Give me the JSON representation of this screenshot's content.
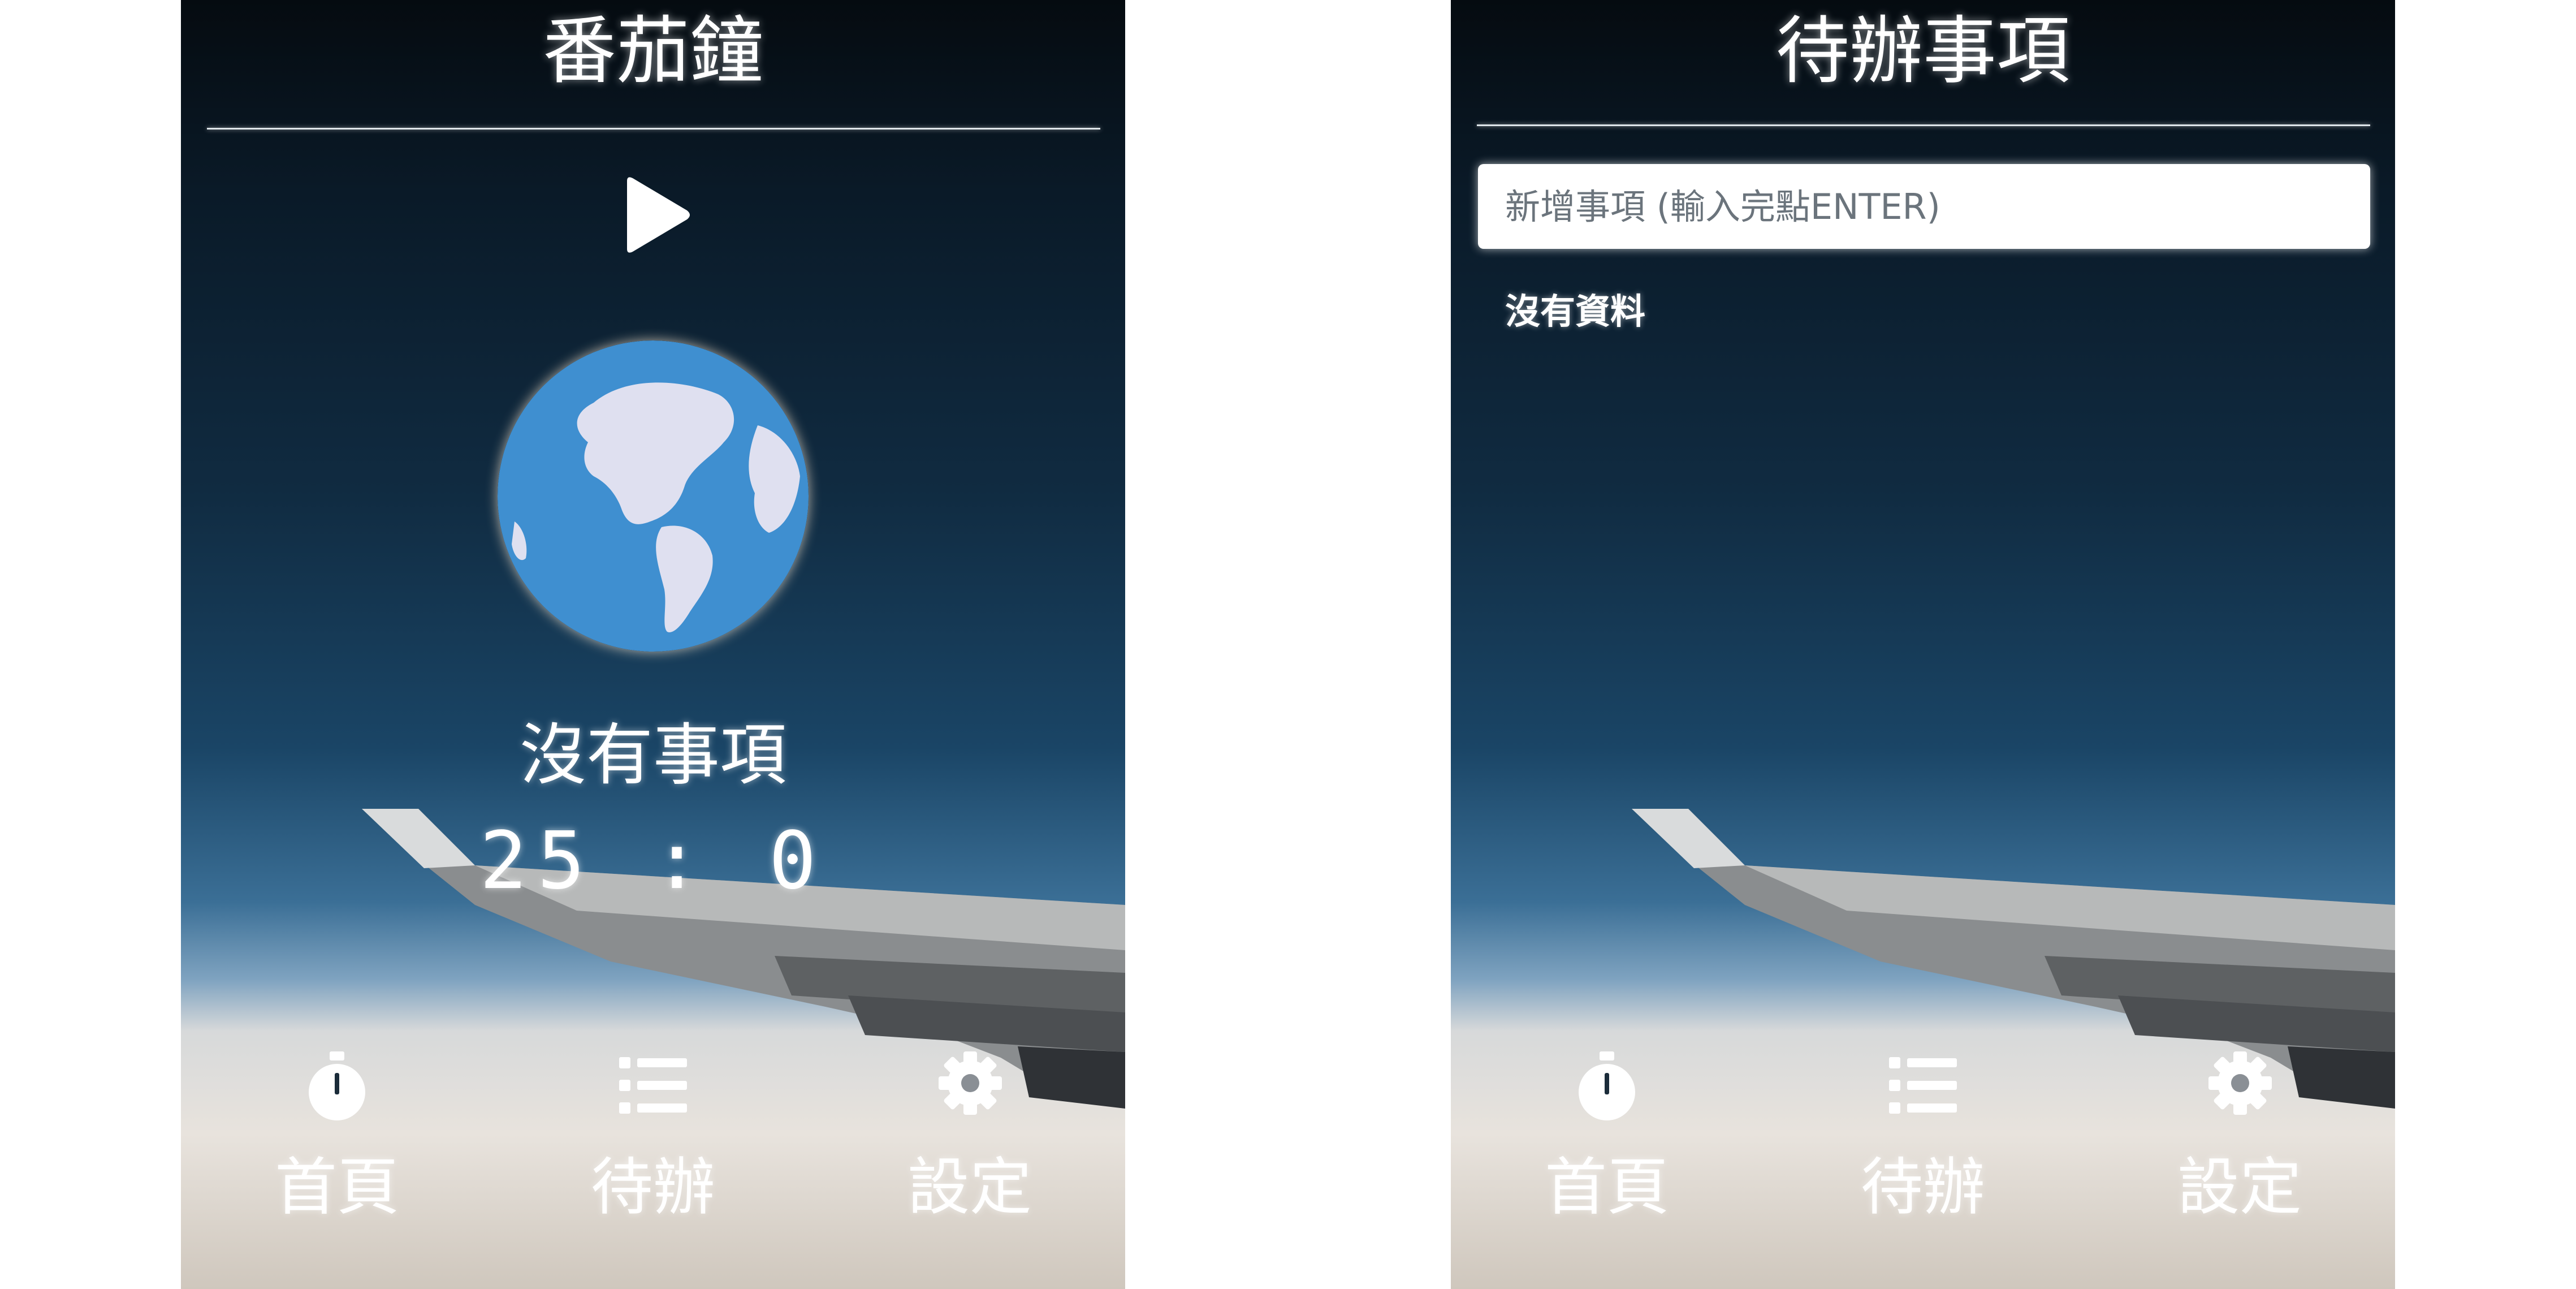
{
  "screens": {
    "timer": {
      "title": "番茄鐘",
      "task_name": "沒有事項",
      "timer": "25 : 0"
    },
    "todo": {
      "title": "待辦事項",
      "input_placeholder": "新增事項 (輸入完點ENTER)",
      "empty_text": "沒有資料"
    }
  },
  "nav": {
    "home_label": "首頁",
    "todo_label": "待辦",
    "settings_label": "設定"
  },
  "icons": {
    "play": "play-icon",
    "globe": "globe-icon",
    "home": "stopwatch-icon",
    "todo": "list-icon",
    "settings": "gear-icon"
  },
  "colors": {
    "globe_ocean": "#3f8fd0",
    "globe_land": "#dfe0f0",
    "text": "#ffffff"
  }
}
